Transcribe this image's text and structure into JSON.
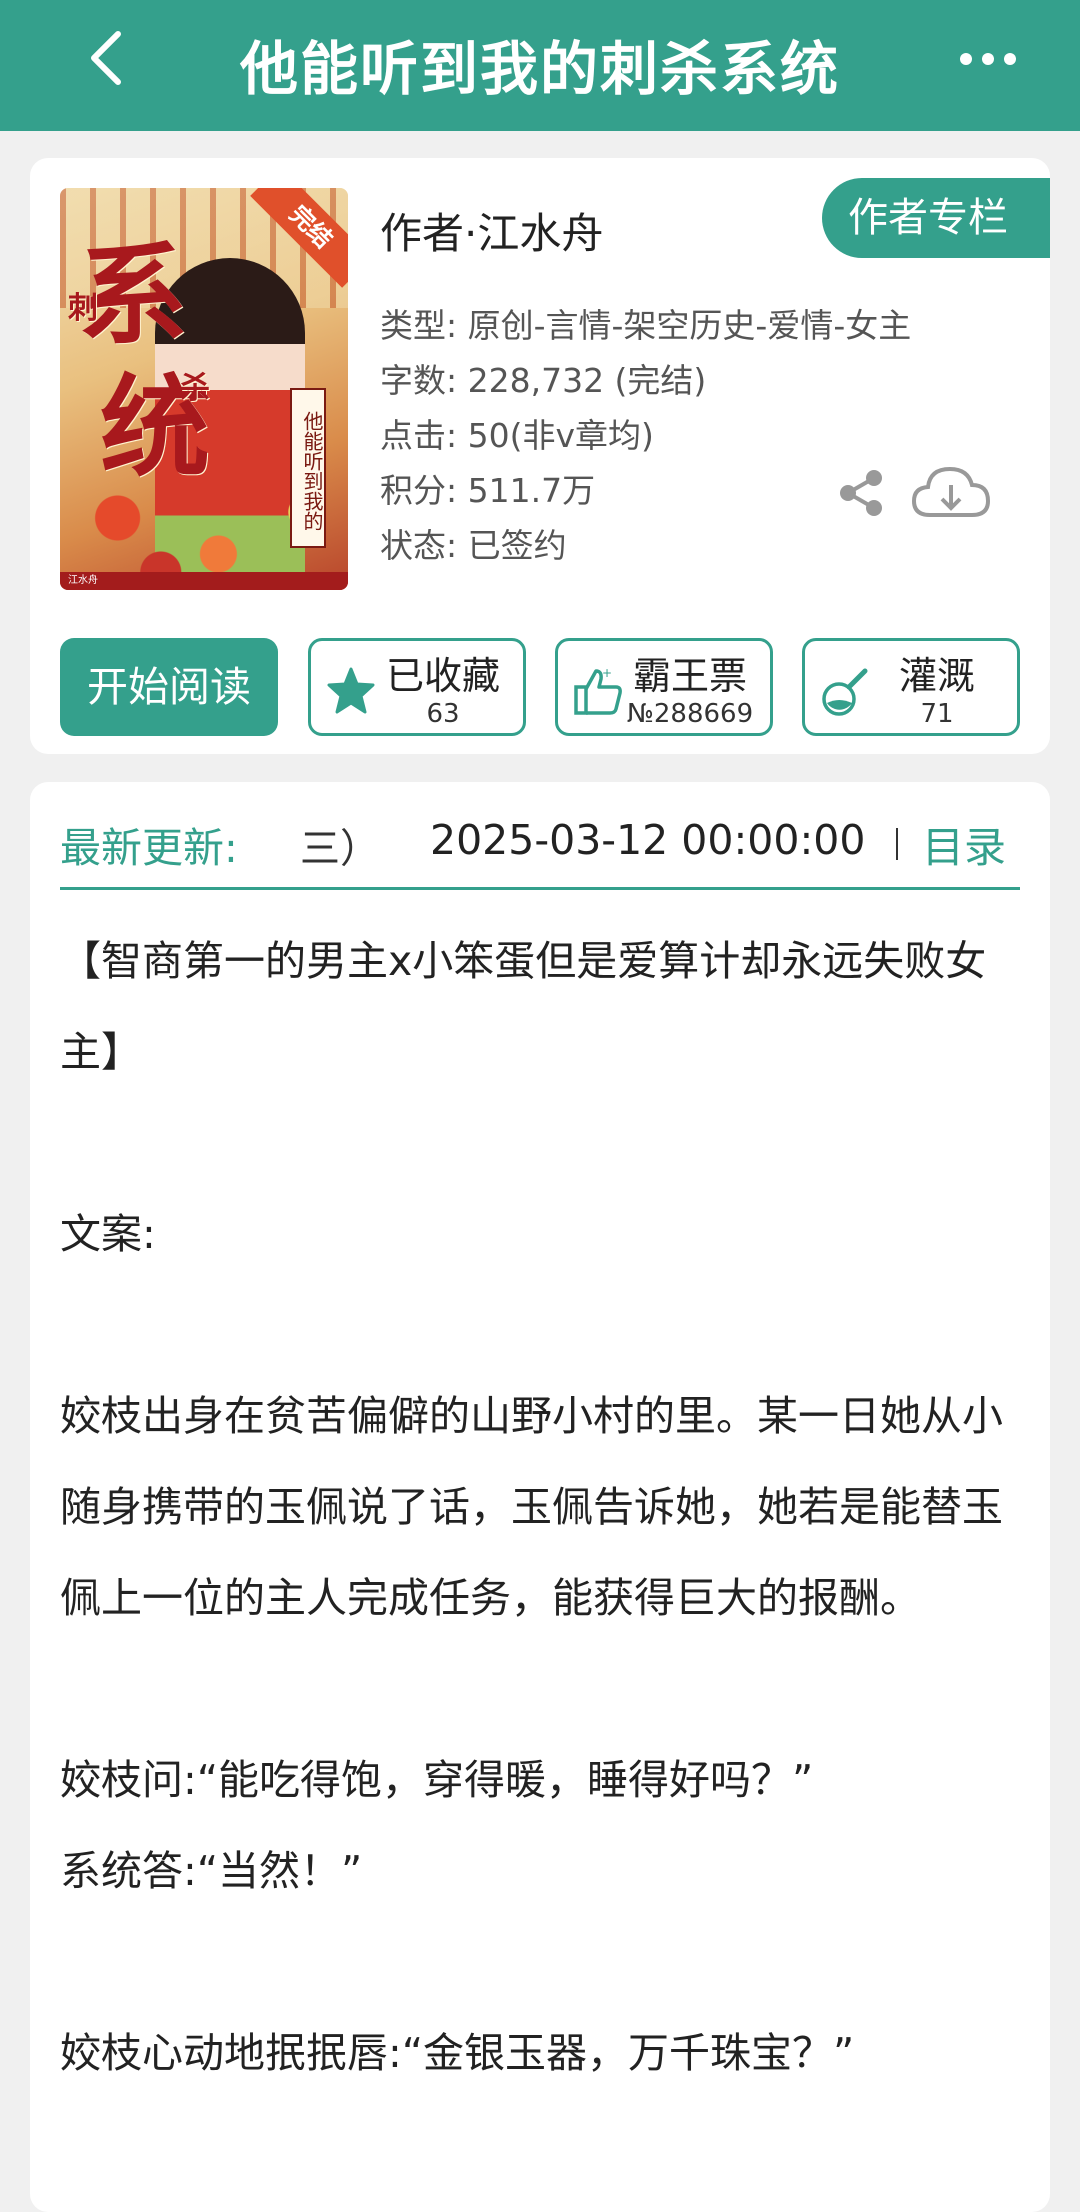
{
  "header": {
    "title": "他能听到我的刺杀系统",
    "back_icon": "chevron-left-icon",
    "more_icon": "more-dots-icon"
  },
  "book": {
    "cover": {
      "badge": "完结",
      "big_chars": [
        "系",
        "统"
      ],
      "small_chars": [
        "刺",
        "杀"
      ],
      "vertical_title": "他能听到我的",
      "author_mark": "江水舟"
    },
    "author_label": "作者·江水舟",
    "author_column_button": "作者专栏",
    "meta": [
      "类型: 原创-言情-架空历史-爱情-女主",
      "字数: 228,732 (完结)",
      "点击: 50(非v章均)",
      "积分: 511.7万",
      "状态: 已签约"
    ]
  },
  "actions": {
    "read_label": "开始阅读",
    "collect": {
      "label": "已收藏",
      "count": "63"
    },
    "vote": {
      "label": "霸王票",
      "count": "№288669"
    },
    "water": {
      "label": "灌溉",
      "count": "71"
    }
  },
  "update": {
    "label": "最新更新:",
    "chapter_fragment": "三）",
    "time": "2025-03-12 00:00:00",
    "toc_label": "目录"
  },
  "description": [
    "【智商第一的男主x小笨蛋但是爱算计却永远失败女主】",
    "",
    "文案:",
    "",
    "姣枝出身在贫苦偏僻的山野小村的里。某一日她从小随身携带的玉佩说了话，玉佩告诉她，她若是能替玉佩上一位的主人完成任务，能获得巨大的报酬。",
    "",
    "姣枝问:“能吃得饱，穿得暖，睡得好吗？”",
    "系统答:“当然！”",
    "",
    "姣枝心动地抿抿唇:“金银玉器，万千珠宝？”"
  ],
  "colors": {
    "accent": "#34a08c",
    "background": "#f0f0f0"
  }
}
